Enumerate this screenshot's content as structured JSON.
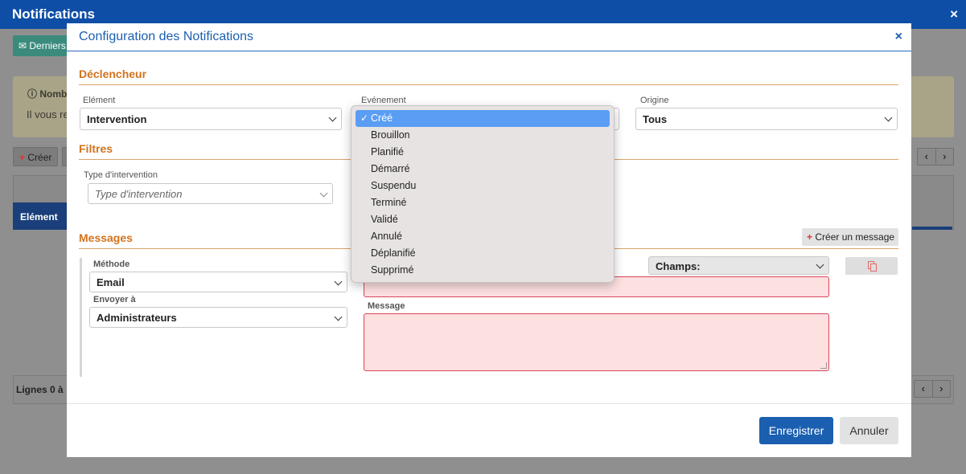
{
  "background": {
    "title": "Notifications",
    "close_glyph": "×",
    "derniers_label": "Derniers",
    "alert_title": "Nomb",
    "alert_text": "Il vous re",
    "creer_label": "Créer",
    "table_header_element": "Elément",
    "footer_text": "Lignes 0 à",
    "pager_prev": "‹",
    "pager_next": "›"
  },
  "modal": {
    "title": "Configuration des Notifications",
    "close_glyph": "×"
  },
  "declencheur": {
    "section_title": "Déclencheur",
    "element_label": "Elément",
    "element_value": "Intervention",
    "evenement_label": "Evénement",
    "origine_label": "Origine",
    "origine_value": "Tous"
  },
  "filtres": {
    "section_title": "Filtres",
    "type_label": "Type d'intervention",
    "type_placeholder": "Type d'intervention"
  },
  "messages": {
    "section_title": "Messages",
    "create_button": "Créer un message",
    "methode_label": "Méthode",
    "methode_value": "Email",
    "envoyer_label": "Envoyer à",
    "envoyer_value": "Administrateurs",
    "champs_value": "Champs:",
    "message_label": "Message"
  },
  "evenement_dropdown": {
    "selected": "Créé",
    "options": [
      "Créé",
      "Brouillon",
      "Planifié",
      "Démarré",
      "Suspendu",
      "Terminé",
      "Validé",
      "Annulé",
      "Déplanifié",
      "Supprimé"
    ]
  },
  "footer": {
    "save_label": "Enregistrer",
    "cancel_label": "Annuler"
  },
  "colors": {
    "primary": "#1b5fb0",
    "section": "#d2731d",
    "error_bg": "#fde0e0",
    "dropdown_selected": "#5a9df5"
  }
}
